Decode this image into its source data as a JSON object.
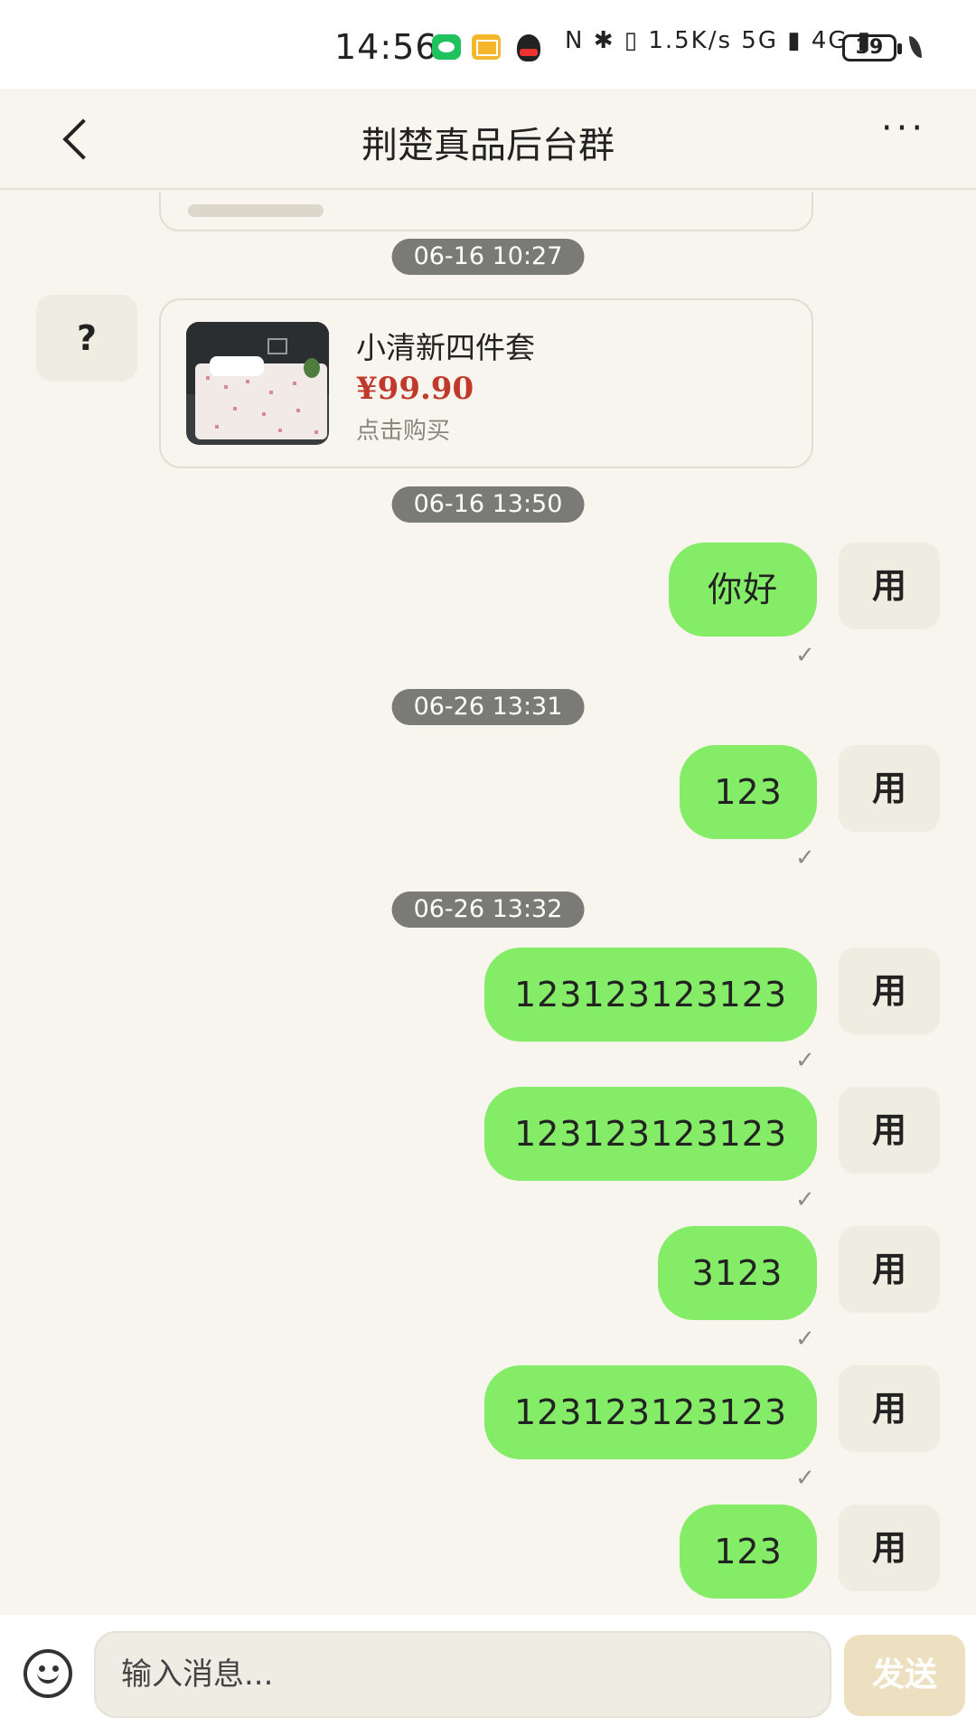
{
  "status": {
    "time": "14:56",
    "icons_text": "N ✱ ▯ 1.5K/s 5G ▮ 4G ▮",
    "battery": "39"
  },
  "header": {
    "title": "荆楚真品后台群",
    "more": "···"
  },
  "chat": {
    "timestamps": [
      "06-16 10:27",
      "06-16 13:50",
      "06-26 13:31",
      "06-26 13:32"
    ],
    "other_avatar": "?",
    "product": {
      "name": "小清新四件套",
      "price": "¥99.90",
      "action": "点击购买"
    },
    "my_avatar": "用",
    "messages": [
      "你好",
      "123",
      "123123123123",
      "123123123123",
      "3123",
      "123123123123",
      "123"
    ],
    "check": "✓"
  },
  "input": {
    "placeholder": "输入消息...",
    "send": "发送"
  }
}
